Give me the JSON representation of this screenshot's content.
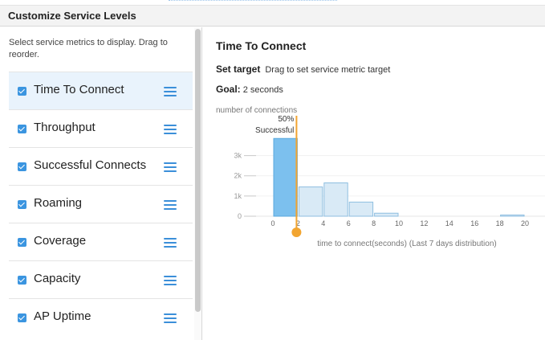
{
  "header": {
    "title": "Customize Service Levels"
  },
  "left": {
    "instructions": "Select service metrics to display. Drag to reorder.",
    "items": [
      {
        "label": "Time To Connect",
        "checked": true,
        "selected": true
      },
      {
        "label": "Throughput",
        "checked": true,
        "selected": false
      },
      {
        "label": "Successful Connects",
        "checked": true,
        "selected": false
      },
      {
        "label": "Roaming",
        "checked": true,
        "selected": false
      },
      {
        "label": "Coverage",
        "checked": true,
        "selected": false
      },
      {
        "label": "Capacity",
        "checked": true,
        "selected": false
      },
      {
        "label": "AP Uptime",
        "checked": true,
        "selected": false
      }
    ]
  },
  "right": {
    "title": "Time To Connect",
    "set_target_label": "Set target",
    "set_target_hint": "Drag to set service metric target",
    "goal_label": "Goal:",
    "goal_value": "2 seconds",
    "target_pct_label": "50%",
    "target_status_label": "Successful"
  },
  "colors": {
    "accent": "#3b95e0",
    "bar_highlight": "#7cc0ee",
    "bar_normal": "#d9eaf6",
    "target_line": "#f2a531"
  },
  "chart_data": {
    "type": "bar",
    "ylabel": "number of connections",
    "xlabel": "time to connect(seconds) (Last 7 days distribution)",
    "x_ticks": [
      "0",
      "2",
      "4",
      "6",
      "8",
      "10",
      "12",
      "14",
      "16",
      "18",
      "20"
    ],
    "y_ticks": [
      "0",
      "1k",
      "2k",
      "3k"
    ],
    "xlim": [
      0,
      20
    ],
    "ylim": [
      0,
      3900
    ],
    "bin_width": 2,
    "bins": [
      {
        "x": 0,
        "value": 3850
      },
      {
        "x": 2,
        "value": 1450
      },
      {
        "x": 4,
        "value": 1650
      },
      {
        "x": 6,
        "value": 700
      },
      {
        "x": 8,
        "value": 150
      },
      {
        "x": 10,
        "value": 0
      },
      {
        "x": 12,
        "value": 0
      },
      {
        "x": 14,
        "value": 0
      },
      {
        "x": 16,
        "value": 0
      },
      {
        "x": 18,
        "value": 60
      }
    ],
    "highlight_below": 2,
    "target_x": 2
  }
}
